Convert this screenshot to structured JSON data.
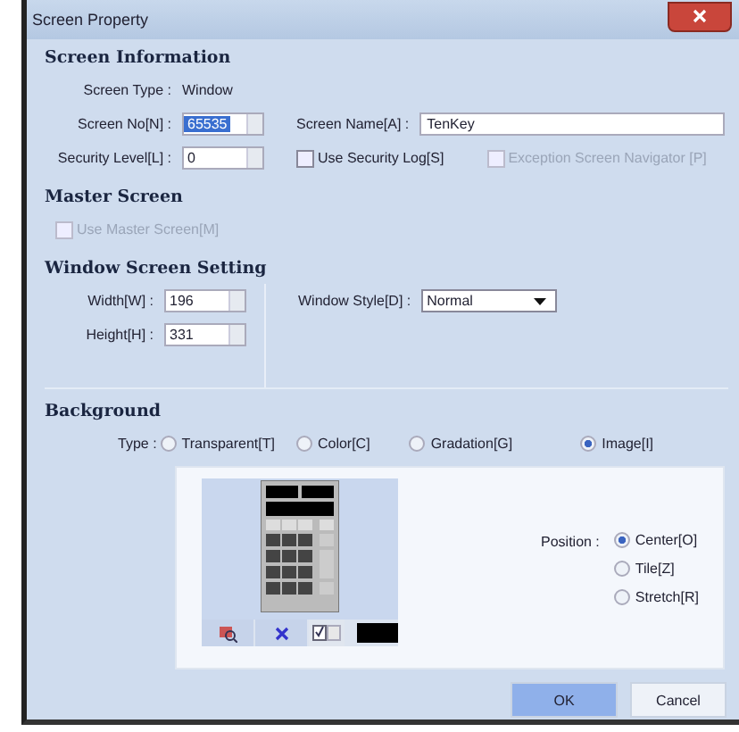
{
  "window": {
    "title": "Screen Property"
  },
  "screen_information": {
    "heading": "Screen Information",
    "screen_type": {
      "label": "Screen Type :",
      "value": "Window"
    },
    "screen_no": {
      "label": "Screen No[N] :",
      "value": "65535",
      "selected": true
    },
    "screen_name": {
      "label": "Screen Name[A] :",
      "value": "TenKey"
    },
    "security_level": {
      "label": "Security Level[L] :",
      "value": "0"
    },
    "checkboxes": [
      {
        "label": "Use Security Log[S]",
        "checked": false,
        "disabled": false
      },
      {
        "label": "Exception Screen Navigator [P]",
        "checked": false,
        "disabled": true
      }
    ]
  },
  "master_screen": {
    "heading": "Master Screen",
    "checkbox": {
      "label": "Use Master Screen[M]",
      "checked": false,
      "disabled": true
    }
  },
  "window_screen_setting": {
    "heading": "Window Screen Setting",
    "width": {
      "label": "Width[W] :",
      "value": "196"
    },
    "height": {
      "label": "Height[H] :",
      "value": "331"
    },
    "window_style": {
      "label": "Window Style[D] :",
      "value": "Normal"
    }
  },
  "background": {
    "heading": "Background",
    "type_label": "Type :",
    "types": [
      {
        "label": "Transparent[T]",
        "selected": false
      },
      {
        "label": "Color[C]",
        "selected": false
      },
      {
        "label": "Gradation[G]",
        "selected": false
      },
      {
        "label": "Image[I]",
        "selected": true
      }
    ],
    "position_label": "Position :",
    "positions": [
      {
        "label": "Center[O]",
        "selected": true
      },
      {
        "label": "Tile[Z]",
        "selected": false
      },
      {
        "label": "Stretch[R]",
        "selected": false
      }
    ]
  },
  "buttons": [
    {
      "label": "OK",
      "kind": "primary"
    },
    {
      "label": "Cancel",
      "kind": "normal"
    }
  ]
}
